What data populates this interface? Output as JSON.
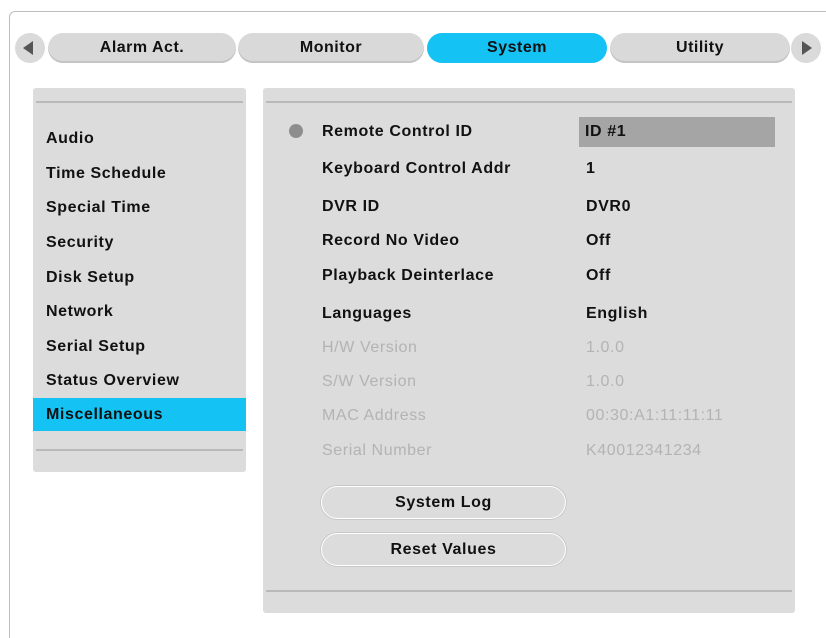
{
  "tabs": {
    "prev_label": "",
    "next_label": "",
    "items": [
      {
        "label": "Alarm Act."
      },
      {
        "label": "Monitor"
      },
      {
        "label": "System"
      },
      {
        "label": "Utility"
      }
    ],
    "active": "System"
  },
  "menu": {
    "items": [
      {
        "label": "Audio"
      },
      {
        "label": "Time Schedule"
      },
      {
        "label": "Special Time"
      },
      {
        "label": "Security"
      },
      {
        "label": "Disk Setup"
      },
      {
        "label": "Network"
      },
      {
        "label": "Serial Setup"
      },
      {
        "label": "Status Overview"
      },
      {
        "label": "Miscellaneous"
      }
    ],
    "active": "Miscellaneous"
  },
  "settings": {
    "rows": [
      {
        "label": "Remote Control ID",
        "value": "ID #1"
      },
      {
        "label": "Keyboard Control Addr",
        "value": "1"
      },
      {
        "label": "DVR ID",
        "value": "DVR0"
      },
      {
        "label": "Record No Video",
        "value": "Off"
      },
      {
        "label": "Playback Deinterlace",
        "value": "Off"
      },
      {
        "label": "Languages",
        "value": "English"
      },
      {
        "label": "H/W Version",
        "value": "1.0.0"
      },
      {
        "label": "S/W Version",
        "value": "1.0.0"
      },
      {
        "label": "MAC Address",
        "value": "00:30:A1:11:11:11"
      },
      {
        "label": "Serial Number",
        "value": "K40012341234"
      }
    ]
  },
  "buttons": {
    "system_log": "System Log",
    "reset_values": "Reset Values"
  },
  "colors": {
    "accent": "#14c2f3",
    "panel": "#dcdcdc",
    "selected_value": "#a5a5a5",
    "disabled_text": "#b3b3b3"
  },
  "icons": {
    "prev": "triangle-left-icon",
    "next": "triangle-right-icon",
    "focus": "radio-bullet-icon"
  }
}
